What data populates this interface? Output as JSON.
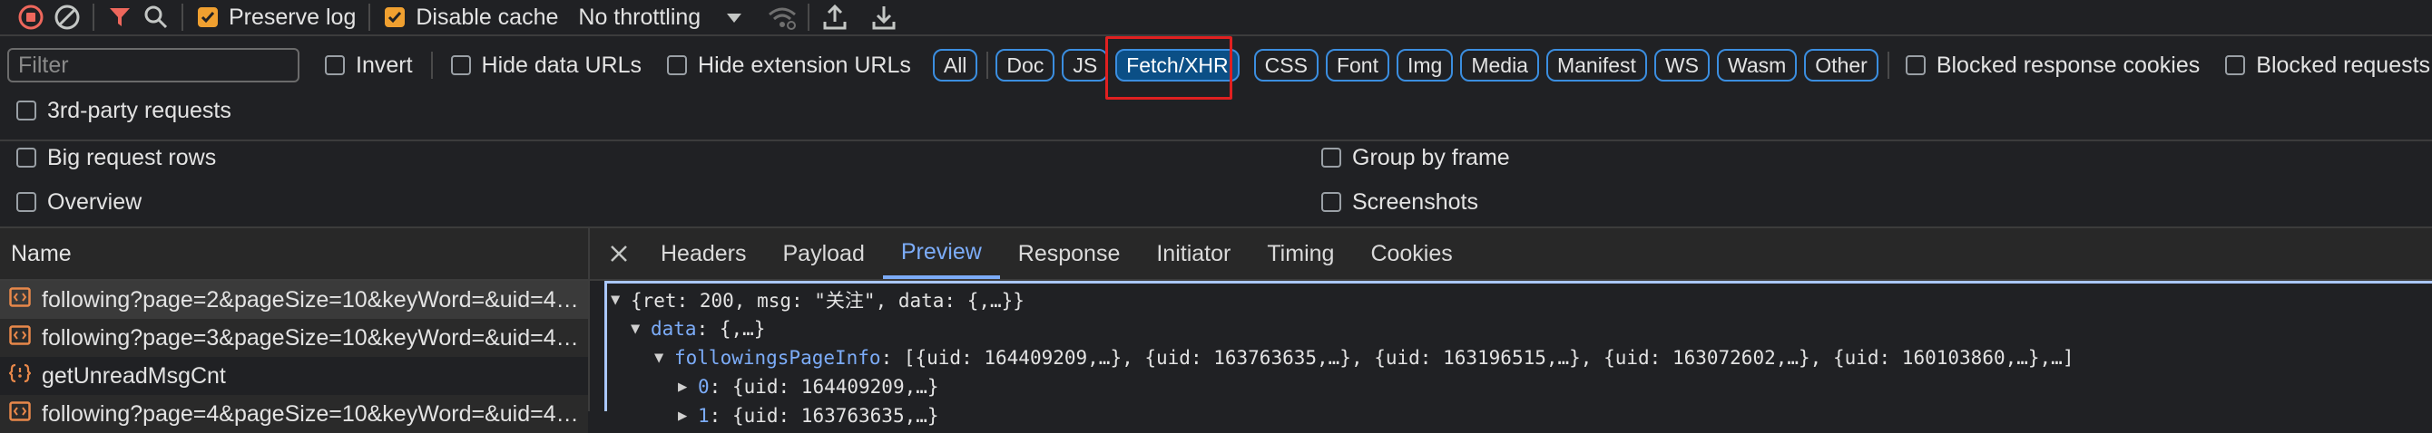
{
  "toolbar": {
    "preserve_log": "Preserve log",
    "disable_cache": "Disable cache",
    "throttling": "No throttling"
  },
  "filterbar": {
    "filter_placeholder": "Filter",
    "invert": "Invert",
    "hide_data_urls": "Hide data URLs",
    "hide_extension_urls": "Hide extension URLs",
    "chips": [
      "All",
      "Doc",
      "JS",
      "Fetch/XHR",
      "CSS",
      "Font",
      "Img",
      "Media",
      "Manifest",
      "WS",
      "Wasm",
      "Other"
    ],
    "selected_chip": "Fetch/XHR",
    "blocked_response_cookies": "Blocked response cookies",
    "blocked_requests": "Blocked requests",
    "third_party": "3rd-party requests"
  },
  "settings": {
    "big_request_rows": "Big request rows",
    "group_by_frame": "Group by frame",
    "overview": "Overview",
    "screenshots": "Screenshots"
  },
  "requests": {
    "header": "Name",
    "items": [
      "following?page=2&pageSize=10&keyWord=&uid=460...",
      "following?page=3&pageSize=10&keyWord=&uid=460...",
      "getUnreadMsgCnt",
      "following?page=4&pageSize=10&keyWord=&uid=460..."
    ]
  },
  "detail": {
    "tabs": [
      "Headers",
      "Payload",
      "Preview",
      "Response",
      "Initiator",
      "Timing",
      "Cookies"
    ],
    "active_tab": "Preview",
    "preview": {
      "line1": "{ret: 200, msg: \"关注\", data: {,…}}",
      "line2_key": "data",
      "line2_val": ": {,…}",
      "line3_key": "followingsPageInfo",
      "line3_val": ": [{uid: 164409209,…}, {uid: 163763635,…}, {uid: 163196515,…}, {uid: 163072602,…}, {uid: 160103860,…},…]",
      "line4_key": "0",
      "line4_val": ": {uid: 164409209,…}",
      "line5_key": "1",
      "line5_val": ": {uid: 163763635,…}"
    }
  },
  "colors": {
    "accent": "#7cacf8",
    "checkbox_on": "#f0a030",
    "highlight_box": "#e02020"
  }
}
